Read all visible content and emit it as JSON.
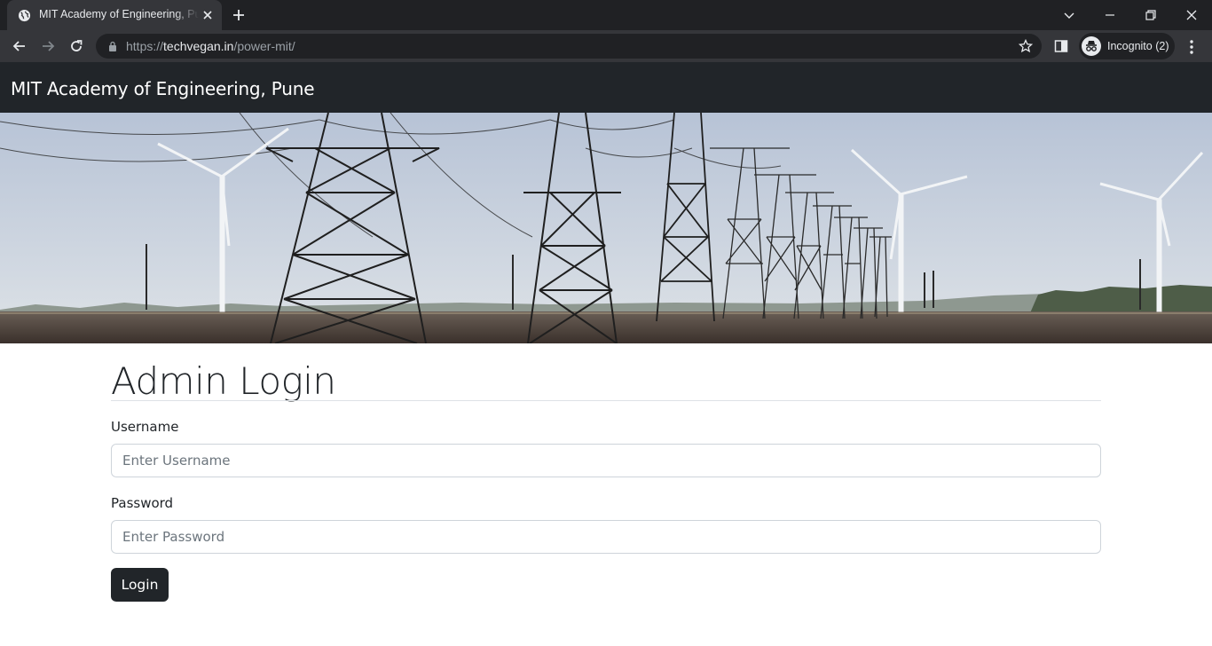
{
  "browser": {
    "tab_title": "MIT Academy of Engineering, Pune",
    "url_scheme": "https://",
    "url_host": "techvegan.in",
    "url_path": "/power-mit/",
    "incognito_label": "Incognito (2)"
  },
  "navbar": {
    "brand": "MIT Academy of Engineering, Pune"
  },
  "login": {
    "heading": "Admin Login",
    "username_label": "Username",
    "username_placeholder": "Enter Username",
    "username_value": "",
    "password_label": "Password",
    "password_placeholder": "Enter Password",
    "password_value": "",
    "button_label": "Login"
  },
  "colors": {
    "navbar_bg": "#212529",
    "button_bg": "#212529",
    "chrome_dark": "#202124",
    "chrome_toolbar": "#35363a"
  },
  "icons": [
    "globe-icon",
    "close-icon",
    "plus-icon",
    "chevron-down-icon",
    "minimize-icon",
    "restore-icon",
    "back-arrow-icon",
    "forward-arrow-icon",
    "reload-icon",
    "lock-icon",
    "star-icon",
    "side-panel-icon",
    "incognito-icon",
    "more-vert-icon"
  ],
  "banner": {
    "subject": "power-transmission-towers-and-wind-turbines-photo"
  }
}
